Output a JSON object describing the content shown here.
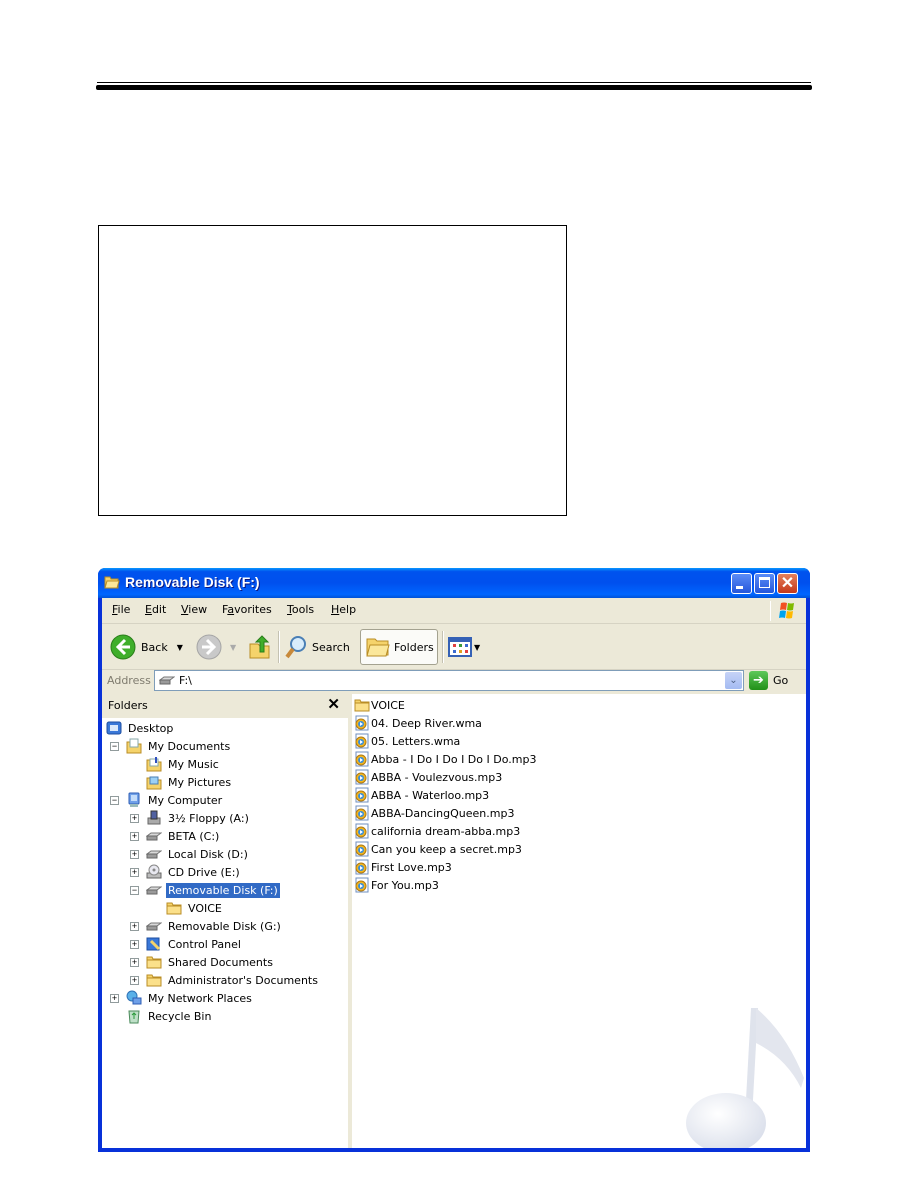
{
  "window": {
    "title": "Removable Disk (F:)",
    "controls": [
      "minimize",
      "maximize",
      "close"
    ]
  },
  "menu": [
    {
      "label": "File",
      "accel": "F"
    },
    {
      "label": "Edit",
      "accel": "E"
    },
    {
      "label": "View",
      "accel": "V"
    },
    {
      "label": "Favorites",
      "accel": "a"
    },
    {
      "label": "Tools",
      "accel": "T"
    },
    {
      "label": "Help",
      "accel": "H"
    }
  ],
  "toolbar": {
    "back_label": "Back",
    "search_label": "Search",
    "folders_label": "Folders"
  },
  "address": {
    "label": "Address",
    "value": "F:\\",
    "go_label": "Go"
  },
  "tree": {
    "title": "Folders",
    "close_glyph": "✕",
    "nodes": [
      {
        "label": "Desktop",
        "icon": "desktop-icon",
        "level": 0,
        "expander": "none"
      },
      {
        "label": "My Documents",
        "icon": "my-documents-icon",
        "level": 1,
        "expander": "minus"
      },
      {
        "label": "My Music",
        "icon": "my-music-icon",
        "level": 2,
        "expander": "none"
      },
      {
        "label": "My Pictures",
        "icon": "my-pictures-icon",
        "level": 2,
        "expander": "none"
      },
      {
        "label": "My Computer",
        "icon": "my-computer-icon",
        "level": 1,
        "expander": "minus"
      },
      {
        "label": "3½ Floppy (A:)",
        "icon": "floppy-drive-icon",
        "level": 2,
        "expander": "plus"
      },
      {
        "label": "BETA (C:)",
        "icon": "hard-disk-icon",
        "level": 2,
        "expander": "plus"
      },
      {
        "label": "Local Disk (D:)",
        "icon": "hard-disk-icon",
        "level": 2,
        "expander": "plus"
      },
      {
        "label": "CD Drive (E:)",
        "icon": "cd-drive-icon",
        "level": 2,
        "expander": "plus"
      },
      {
        "label": "Removable Disk (F:)",
        "icon": "removable-disk-icon",
        "level": 2,
        "expander": "minus",
        "selected": true
      },
      {
        "label": "VOICE",
        "icon": "folder-icon",
        "level": 3,
        "expander": "none"
      },
      {
        "label": "Removable Disk (G:)",
        "icon": "removable-disk-icon",
        "level": 2,
        "expander": "plus"
      },
      {
        "label": "Control Panel",
        "icon": "control-panel-icon",
        "level": 2,
        "expander": "plus"
      },
      {
        "label": "Shared Documents",
        "icon": "folder-icon",
        "level": 2,
        "expander": "plus"
      },
      {
        "label": "Administrator's Documents",
        "icon": "folder-icon",
        "level": 2,
        "expander": "plus"
      },
      {
        "label": "My Network Places",
        "icon": "network-places-icon",
        "level": 1,
        "expander": "plus"
      },
      {
        "label": "Recycle Bin",
        "icon": "recycle-bin-icon",
        "level": 1,
        "expander": "none"
      }
    ]
  },
  "files": [
    {
      "name": "VOICE",
      "type": "folder"
    },
    {
      "name": "04. Deep River.wma",
      "type": "media"
    },
    {
      "name": "05. Letters.wma",
      "type": "media"
    },
    {
      "name": "Abba - I Do I Do I Do I Do.mp3",
      "type": "media"
    },
    {
      "name": "ABBA - Voulezvous.mp3",
      "type": "media"
    },
    {
      "name": "ABBA - Waterloo.mp3",
      "type": "media"
    },
    {
      "name": "ABBA-DancingQueen.mp3",
      "type": "media"
    },
    {
      "name": "california dream-abba.mp3",
      "type": "media"
    },
    {
      "name": "Can you keep a secret.mp3",
      "type": "media"
    },
    {
      "name": "First Love.mp3",
      "type": "media"
    },
    {
      "name": "For You.mp3",
      "type": "media"
    }
  ],
  "colors": {
    "title_bar": "#0053ee",
    "selection": "#316ac5",
    "chrome": "#ece9d8"
  }
}
